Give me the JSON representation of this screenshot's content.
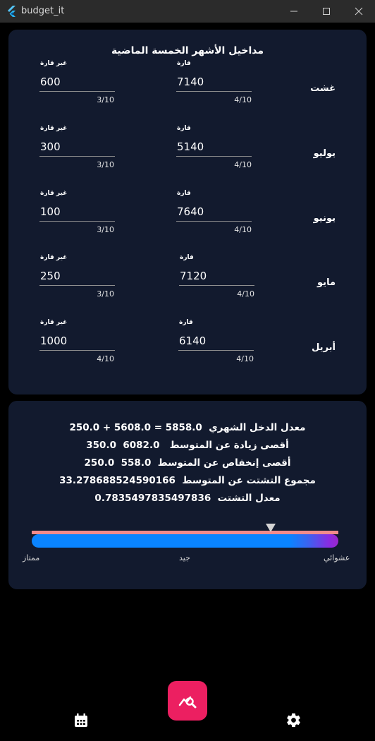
{
  "window": {
    "title": "budget_it"
  },
  "history": {
    "title": "مداخيل الأشهر الخمسة الماضية",
    "fixed_label": "قارة",
    "variable_label": "غير قارة",
    "months": [
      {
        "name": "غشت",
        "fixed": "7140",
        "fixed_count": "4/10",
        "variable": "600",
        "variable_count": "3/10"
      },
      {
        "name": "يوليو",
        "fixed": "5140",
        "fixed_count": "4/10",
        "variable": "300",
        "variable_count": "3/10"
      },
      {
        "name": "يونيو",
        "fixed": "7640",
        "fixed_count": "4/10",
        "variable": "100",
        "variable_count": "3/10"
      },
      {
        "name": "مايو",
        "fixed": "7120",
        "fixed_count": "4/10",
        "variable": "250",
        "variable_count": "3/10"
      },
      {
        "name": "أبريل",
        "fixed": "6140",
        "fixed_count": "4/10",
        "variable": "1000",
        "variable_count": "4/10"
      }
    ]
  },
  "stats": {
    "lines": [
      "250.0 + 5608.0 = 5858.0  معدل الدخل الشهري",
      "350.0  6082.0   أقصى زيادة عن المتوسط",
      "250.0  558.0  أقصى إنخفاص عن المتوسط",
      "33.278688524590166  مجموع التشتت عن المتوسط",
      "0.7835497835497836  معدل التشتت"
    ],
    "gauge_value": 0.78,
    "scale_labels": {
      "left": "ممتاز",
      "middle": "جيد",
      "right": "عشوائي"
    }
  },
  "colors": {
    "card": "#121a2e",
    "accent": "#ec1f61",
    "gauge": "#0a84ff",
    "gauge_end": "#9b27c9"
  },
  "nav": {
    "left_icon": "calendar-icon",
    "center_icon": "analytics-search-icon",
    "right_icon": "gear-icon"
  }
}
